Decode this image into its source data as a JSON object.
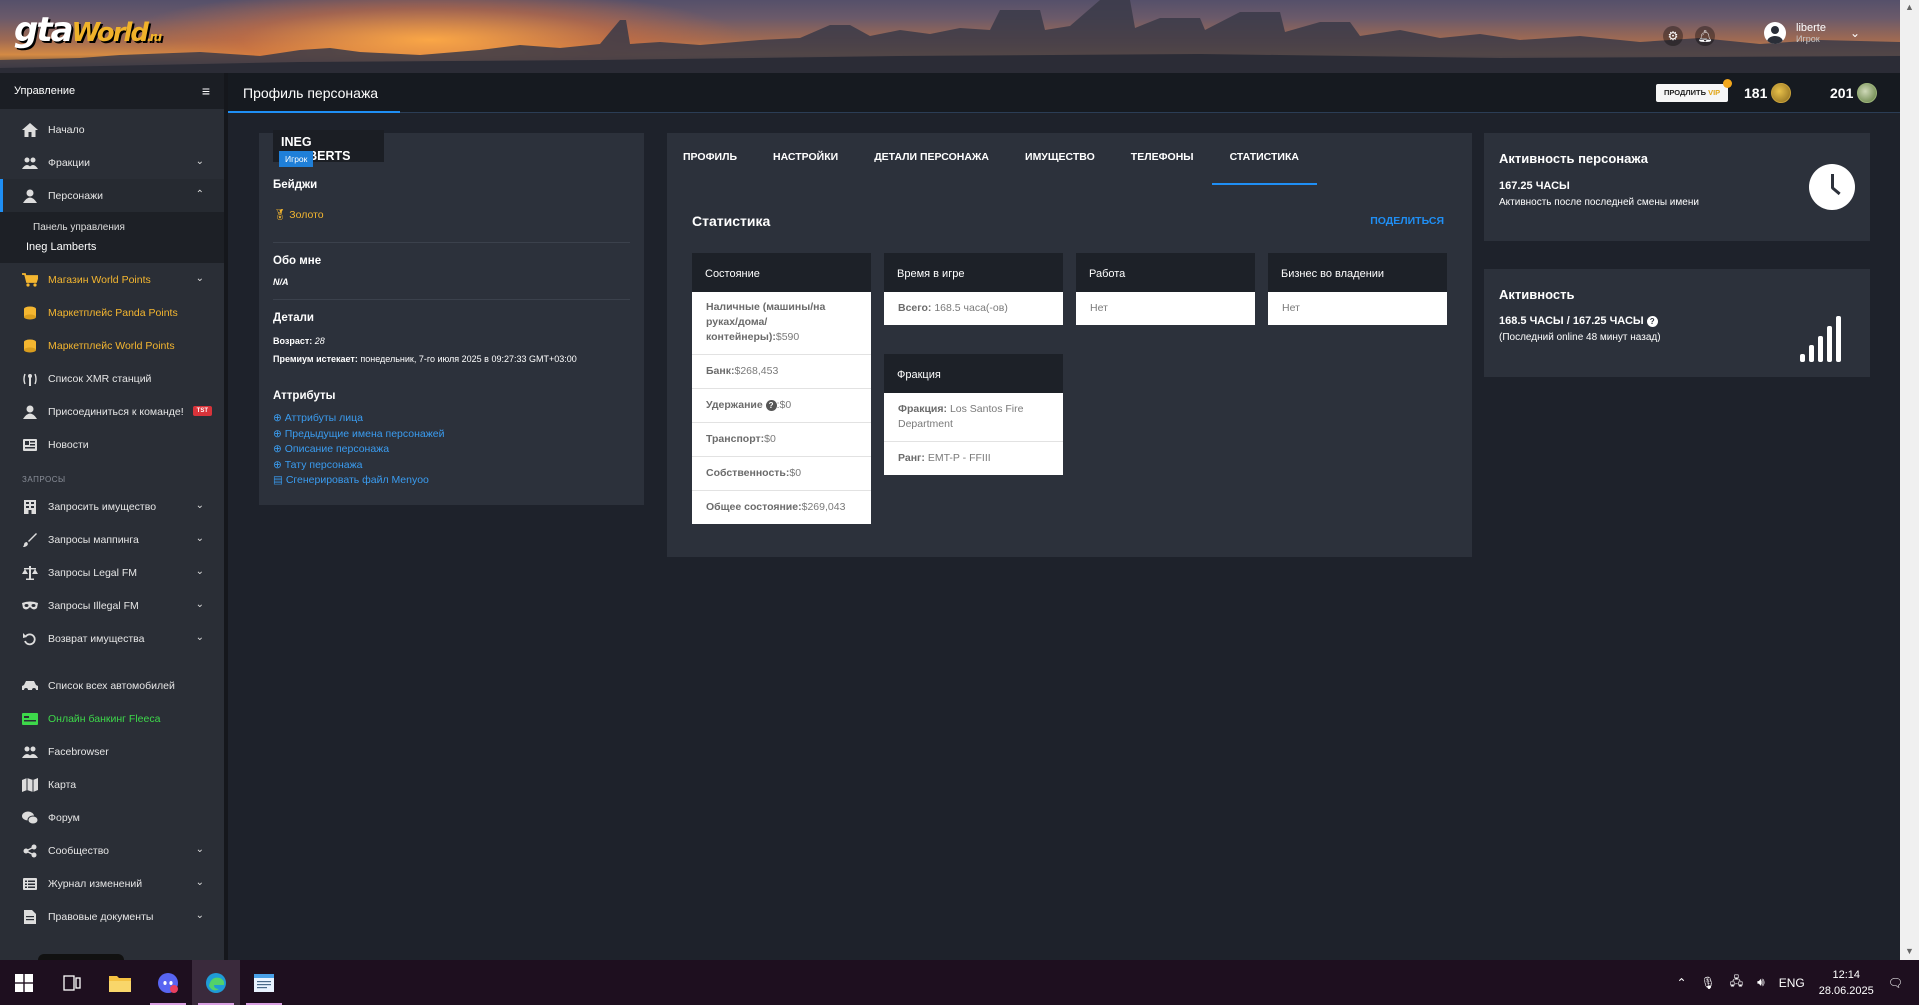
{
  "header": {
    "logo_main": "gta",
    "logo_world": "World",
    "logo_tld": ".ru",
    "user_name": "liberte",
    "user_role": "Игрок"
  },
  "sidebar": {
    "title": "Управление",
    "items": [
      {
        "label": "Начало",
        "icon": "home-icon"
      },
      {
        "label": "Фракции",
        "icon": "users-icon"
      },
      {
        "label": "Персонажи",
        "icon": "user-icon"
      }
    ],
    "sub_items": [
      "Панель управления",
      "Ineg Lamberts"
    ],
    "shop": [
      "Магазин World Points",
      "Маркетплейс Panda Points",
      "Маркетплейс World Points"
    ],
    "misc": [
      {
        "label": "Список XMR станций",
        "icon": "antenna-icon"
      },
      {
        "label": "Присоединиться к команде!",
        "icon": "user-icon",
        "badge": "TST"
      },
      {
        "label": "Новости",
        "icon": "news-icon"
      }
    ],
    "section_requests": "ЗАПРОСЫ",
    "requests": [
      {
        "label": "Запросить имущество",
        "icon": "building-icon"
      },
      {
        "label": "Запросы маппинга",
        "icon": "brush-icon"
      },
      {
        "label": "Запросы Legal FM",
        "icon": "scale-icon"
      },
      {
        "label": "Запросы Illegal FM",
        "icon": "mask-icon"
      },
      {
        "label": "Возврат имущества",
        "icon": "undo-icon"
      }
    ],
    "bottom": [
      {
        "label": "Список всех автомобилей",
        "icon": "car-icon"
      },
      {
        "label": "Онлайн банкинг Fleeca",
        "icon": "bank-icon"
      },
      {
        "label": "Facebrowser",
        "icon": "users-icon"
      },
      {
        "label": "Карта",
        "icon": "map-icon"
      },
      {
        "label": "Форум",
        "icon": "chat-icon"
      },
      {
        "label": "Сообщество",
        "icon": "share-icon"
      },
      {
        "label": "Журнал изменений",
        "icon": "list-icon"
      },
      {
        "label": "Правовые документы",
        "icon": "document-icon"
      }
    ]
  },
  "topbar": {
    "page_title": "Профиль персонажа",
    "vip_prefix": "ПРОДЛИТЬ",
    "vip_word": "VIP",
    "points_gold": "181",
    "points_green": "201"
  },
  "profile": {
    "name": "INEG LAMBERTS",
    "role": "Игрок",
    "badges_title": "Бейджи",
    "badge": "Золото",
    "about_title": "Обо мне",
    "about_value": "N/A",
    "details_title": "Детали",
    "age_label": "Возраст:",
    "age_value": "28",
    "premium_label": "Премиум истекает:",
    "premium_value": "понедельник, 7-го июля 2025 в 09:27:33 GMT+03:00",
    "attributes_title": "Аттрибуты",
    "attributes": [
      "Аттрибуты лица",
      "Предыдущие имена персонажей",
      "Описание персонажа",
      "Тату персонажа",
      "Сгенерировать файл Menyoo"
    ]
  },
  "tabs": [
    "ПРОФИЛЬ",
    "НАСТРОЙКИ",
    "ДЕТАЛИ ПЕРСОНАЖА",
    "ИМУЩЕСТВО",
    "ТЕЛЕФОНЫ",
    "СТАТИСТИКА"
  ],
  "stats": {
    "title": "Статистика",
    "share": "ПОДЕЛИТЬСЯ",
    "state": {
      "title": "Состояние",
      "cash_label": "Наличные (машины/на руках/дома/контейнеры):",
      "cash": "$590",
      "bank_label": "Банк:",
      "bank": "$268,453",
      "hold_label": "Удержание",
      "hold": ":$0",
      "transport_label": "Транспорт:",
      "transport": "$0",
      "property_label": "Собственность:",
      "property": "$0",
      "total_label": "Общее состояние:",
      "total": "$269,043"
    },
    "playtime": {
      "title": "Время в игре",
      "total_label": "Всего:",
      "total": "168.5 часа(-ов)"
    },
    "work": {
      "title": "Работа",
      "value": "Нет"
    },
    "business": {
      "title": "Бизнес во владении",
      "value": "Нет"
    },
    "faction": {
      "title": "Фракция",
      "faction_label": "Фракция:",
      "faction": "Los Santos Fire Department",
      "rank_label": "Ранг:",
      "rank": "EMT-P - FFIII"
    }
  },
  "activity": {
    "char_title": "Активность персонажа",
    "char_hours": "167.25 ЧАСЫ",
    "char_sub": "Активность после последней смены имени",
    "title": "Активность",
    "hours": "168.5 ЧАСЫ / 167.25 ЧАСЫ",
    "last_online": "(Последний online 48 минут назад)"
  },
  "taskbar": {
    "lang": "ENG",
    "time": "12:14",
    "date": "28.06.2025"
  }
}
